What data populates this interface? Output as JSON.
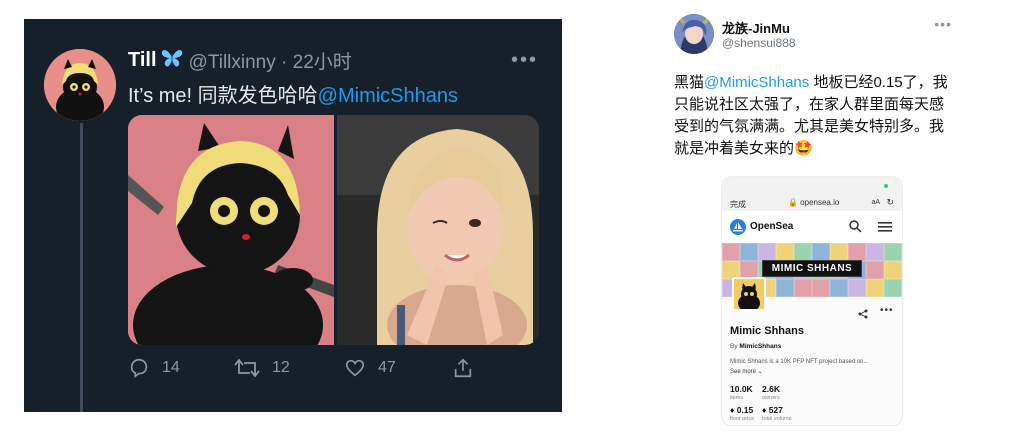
{
  "left_tweet": {
    "author_name": "Till",
    "butterfly_icon": "butterfly-emoji",
    "handle_time": "@Tillxinny · 22小时",
    "text_prefix": "It’s me! 同款发色哈哈",
    "mention": "@MimicShhans",
    "more": "•••",
    "actions": {
      "reply": "14",
      "retweet": "12",
      "like": "47"
    },
    "colors": {
      "background": "#15202b",
      "accent": "#1d9bf0"
    }
  },
  "right_tweet": {
    "author_name": "龙族-JinMu",
    "handle": "@shensui888",
    "more": "•••",
    "text_line1_prefix": "黑猫",
    "mention": "@MimicShhans",
    "text_line1_suffix": " 地板已经0.15",
    "text_rest": "了，我只能说社区太强了，在家人群里面每天感受到的气氛满满。尤其是美女特别多。我就是冲着美女来的🤩",
    "phone": {
      "done": "完成",
      "url": "🔒 opensea.io",
      "aa": "aA",
      "reload": "↻",
      "brand": "OpenSea",
      "banner_title": "MIMIC SHHANS",
      "collection_name": "Mimic Shhans",
      "by_label": "By",
      "by_name": "MimicShhans",
      "description": "Mimic Shhans is a 10K PFP NFT project based on...",
      "see_more": "See more ⌄",
      "items_value": "10.0K",
      "items_label": "items",
      "owners_value": "2.6K",
      "owners_label": "owners",
      "floor_value": "♦ 0.15",
      "floor_label": "floor price",
      "volume_value": "♦ 527",
      "volume_label": "total volume"
    }
  }
}
